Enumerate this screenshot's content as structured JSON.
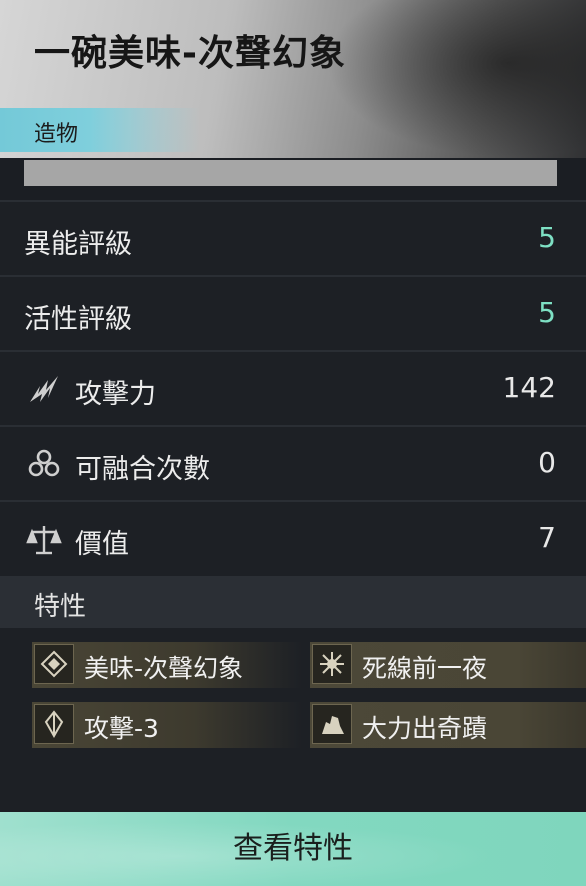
{
  "item": {
    "title": "一碗美味-次聲幻象",
    "category": "造物"
  },
  "stats": [
    {
      "label": "異能評級",
      "value": "5",
      "icon": ""
    },
    {
      "label": "活性評級",
      "value": "5",
      "icon": ""
    },
    {
      "label": "攻擊力",
      "value": "142",
      "icon": "claw-strike-icon"
    },
    {
      "label": "可融合次數",
      "value": "0",
      "icon": "knot-icon"
    },
    {
      "label": "價值",
      "value": "7",
      "icon": "balance-scale-icon"
    }
  ],
  "traits_section": {
    "label": "特性",
    "items": [
      {
        "label": "美味-次聲幻象",
        "icon": "diamond-icon"
      },
      {
        "label": "死線前一夜",
        "icon": "starburst-icon"
      },
      {
        "label": "攻擊-3",
        "icon": "crystal-icon"
      },
      {
        "label": "大力出奇蹟",
        "icon": "flex-arm-icon"
      }
    ]
  },
  "actions": {
    "view_traits_label": "查看特性"
  },
  "colors": {
    "accent_teal": "#7ee0c4",
    "button_teal": "#82d8c0",
    "category_cyan": "#7fcfdc"
  }
}
